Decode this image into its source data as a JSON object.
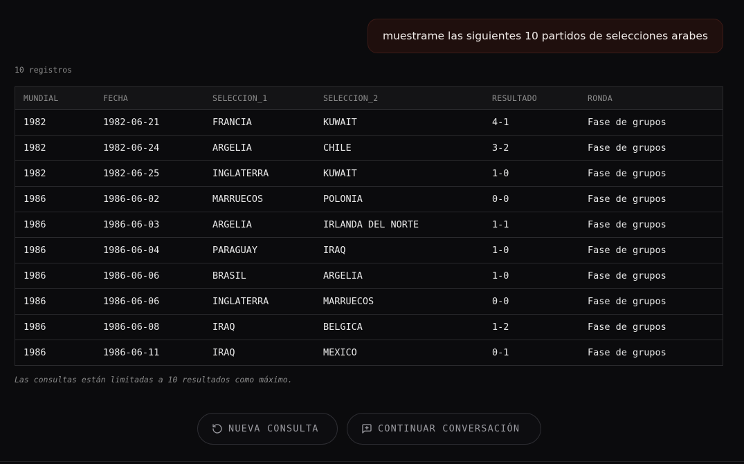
{
  "chat": {
    "user_message": "muestrame las siguientes 10 partidos de selecciones arabes"
  },
  "result": {
    "record_count": "10 registros",
    "columns": [
      "MUNDIAL",
      "FECHA",
      "SELECCION_1",
      "SELECCION_2",
      "RESULTADO",
      "RONDA"
    ],
    "rows": [
      [
        "1982",
        "1982-06-21",
        "FRANCIA",
        "KUWAIT",
        "4-1",
        "Fase de grupos"
      ],
      [
        "1982",
        "1982-06-24",
        "ARGELIA",
        "CHILE",
        "3-2",
        "Fase de grupos"
      ],
      [
        "1982",
        "1982-06-25",
        "INGLATERRA",
        "KUWAIT",
        "1-0",
        "Fase de grupos"
      ],
      [
        "1986",
        "1986-06-02",
        "MARRUECOS",
        "POLONIA",
        "0-0",
        "Fase de grupos"
      ],
      [
        "1986",
        "1986-06-03",
        "ARGELIA",
        "IRLANDA DEL NORTE",
        "1-1",
        "Fase de grupos"
      ],
      [
        "1986",
        "1986-06-04",
        "PARAGUAY",
        "IRAQ",
        "1-0",
        "Fase de grupos"
      ],
      [
        "1986",
        "1986-06-06",
        "BRASIL",
        "ARGELIA",
        "1-0",
        "Fase de grupos"
      ],
      [
        "1986",
        "1986-06-06",
        "INGLATERRA",
        "MARRUECOS",
        "0-0",
        "Fase de grupos"
      ],
      [
        "1986",
        "1986-06-08",
        "IRAQ",
        "BELGICA",
        "1-2",
        "Fase de grupos"
      ],
      [
        "1986",
        "1986-06-11",
        "IRAQ",
        "MEXICO",
        "0-1",
        "Fase de grupos"
      ]
    ],
    "limit_note": "Las consultas están limitadas a 10 resultados como máximo."
  },
  "actions": {
    "new_query_label": "NUEVA CONSULTA",
    "new_query_icon": "rotate-ccw-icon",
    "continue_label": "CONTINUAR CONVERSACIÓN",
    "continue_icon": "message-plus-icon"
  },
  "colors": {
    "background": "#0b0b0d",
    "user_bubble_bg": "#1f0f0d",
    "user_bubble_border": "#3d1b17",
    "table_border": "#2a2a2d",
    "muted_text": "#8a8a8a"
  }
}
